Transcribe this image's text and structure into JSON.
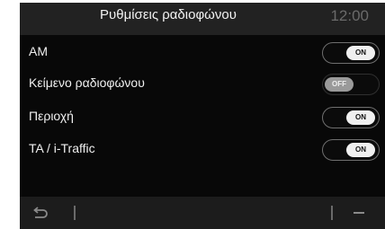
{
  "header": {
    "title": "Ρυθμίσεις ραδιοφώνου",
    "clock": "12:00"
  },
  "settings": [
    {
      "label": "AM",
      "state": "ON",
      "enabled": true
    },
    {
      "label": "Κείμενο ραδιοφώνου",
      "state": "OFF",
      "enabled": false
    },
    {
      "label": "Περιοχή",
      "state": "ON",
      "enabled": true
    },
    {
      "label": "TA / i-Traffic",
      "state": "ON",
      "enabled": true
    }
  ],
  "footer": {
    "back_icon": "back-arrow-icon",
    "menu_icon": "menu-dash-icon"
  },
  "colors": {
    "screen_background": "#080808",
    "header_background": "#222222",
    "footer_background": "#1c1c1c",
    "toggle_on_knob": "#f0f0f0",
    "toggle_off_knob": "#9a9a9a"
  }
}
